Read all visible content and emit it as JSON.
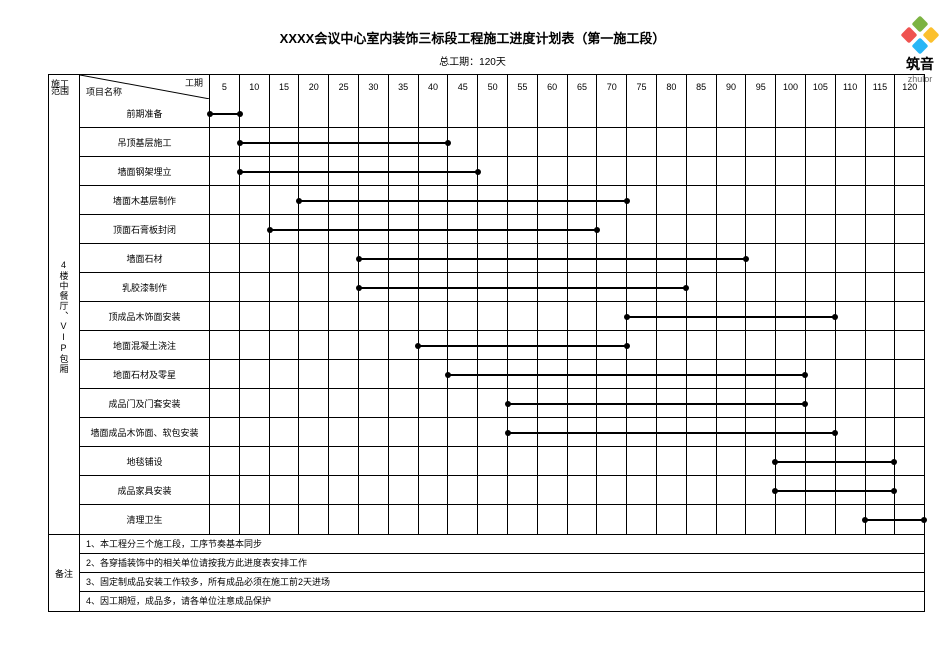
{
  "title": "XXXX会议中心室内装饰三标段工程施工进度计划表（第一施工段）",
  "subtitle": "总工期：120天",
  "logo": {
    "cn": "筑音",
    "en": "zhulor"
  },
  "header": {
    "range_top": "施工",
    "range_bot": "范围",
    "diag_top": "工期",
    "diag_bot": "项目名称"
  },
  "range_label": "4楼中餐厅、VIP包厢",
  "notes_label": "备注",
  "chart_data": {
    "type": "bar",
    "title": "XXXX会议中心室内装饰三标段工程施工进度计划表（第一施工段）",
    "xlabel": "工期(天)",
    "ylabel": "项目名称",
    "xlim": [
      0,
      120
    ],
    "x_ticks": [
      5,
      10,
      15,
      20,
      25,
      30,
      35,
      40,
      45,
      50,
      55,
      60,
      65,
      70,
      75,
      80,
      85,
      90,
      95,
      100,
      105,
      110,
      115,
      120
    ],
    "tasks": [
      {
        "name": "前期准备",
        "start": 0,
        "end": 5
      },
      {
        "name": "吊顶基层施工",
        "start": 5,
        "end": 40
      },
      {
        "name": "墙面钢架埋立",
        "start": 5,
        "end": 45
      },
      {
        "name": "墙面木基层制作",
        "start": 15,
        "end": 70
      },
      {
        "name": "顶面石膏板封闭",
        "start": 10,
        "end": 65
      },
      {
        "name": "墙面石材",
        "start": 25,
        "end": 90
      },
      {
        "name": "乳胶漆制作",
        "start": 25,
        "end": 80
      },
      {
        "name": "顶成品木饰面安装",
        "start": 70,
        "end": 105
      },
      {
        "name": "地面混凝土浇注",
        "start": 35,
        "end": 70
      },
      {
        "name": "地面石材及零星",
        "start": 40,
        "end": 100
      },
      {
        "name": "成品门及门套安装",
        "start": 50,
        "end": 100
      },
      {
        "name": "墙面成品木饰面、软包安装",
        "start": 50,
        "end": 105
      },
      {
        "name": "地毯铺设",
        "start": 95,
        "end": 115
      },
      {
        "name": "成品家具安装",
        "start": 95,
        "end": 115
      },
      {
        "name": "清理卫生",
        "start": 110,
        "end": 120
      }
    ]
  },
  "notes": [
    "1、本工程分三个施工段，工序节奏基本同步",
    "2、各穿插装饰中的相关单位请按我方此进度表安排工作",
    "3、固定制成品安装工作较多，所有成品必须在施工前2天进场",
    "4、因工期短，成品多，请各单位注意成品保护"
  ]
}
